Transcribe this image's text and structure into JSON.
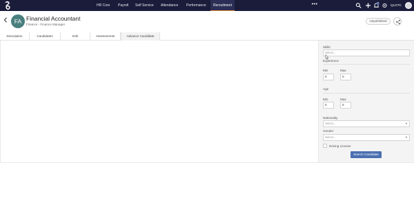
{
  "topnav": {
    "items": [
      "HR Core",
      "Payroll",
      "Self Service",
      "Attendance",
      "Performance",
      "Recruitment"
    ],
    "active": "Recruitment",
    "more": "•••",
    "badge_count": "8",
    "org": "QLGTC"
  },
  "header": {
    "avatar_initials": "FA",
    "title": "Financial Accountant",
    "subtitle": "Finance - Finance Manager",
    "status_button": "Unpublished"
  },
  "tabs": [
    "Description",
    "Candidates",
    "Edit",
    "Assessments",
    "Advance Candidate Search"
  ],
  "search": {
    "skills_label": "Skills",
    "skills_placeholder": "Select...",
    "experience_label": "Experience",
    "exp_min_label": "Min",
    "exp_min_value": "0",
    "exp_max_label": "Max",
    "exp_max_value": "0",
    "age_label": "Age",
    "age_min_label": "Min",
    "age_min_value": "0",
    "age_max_label": "Max",
    "age_max_value": "0",
    "nationality_label": "Nationality",
    "nationality_placeholder": "Select...",
    "gender_label": "Gender",
    "gender_placeholder": "Select...",
    "driving_license_label": "Driving License",
    "submit_label": "Search Candidate"
  },
  "colors": {
    "nav_bg": "#1b1c3a",
    "active_underline": "#f08a3a",
    "avatar_bg": "#4a7f7f",
    "primary_button": "#4b6fb0"
  },
  "icons": [
    "logo-icon",
    "back-arrow-icon",
    "search-icon",
    "plus-icon",
    "bell-icon",
    "gear-icon",
    "share-icon",
    "chevron-down-icon",
    "cursor-icon"
  ]
}
